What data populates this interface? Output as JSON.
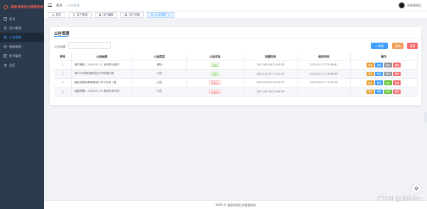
{
  "app": {
    "title": "温泉有家后台管理系统"
  },
  "sidebar": {
    "items": [
      {
        "label": "首页",
        "icon": "dashboard-icon",
        "active": false
      },
      {
        "label": "用户管理",
        "icon": "user-icon",
        "active": false
      },
      {
        "label": "公告管理",
        "icon": "notice-icon",
        "active": true
      },
      {
        "label": "借阅管理",
        "icon": "borrow-icon",
        "active": false
      },
      {
        "label": "图书管理",
        "icon": "book-icon",
        "active": false
      },
      {
        "label": "社区",
        "icon": "community-icon",
        "active": false
      }
    ]
  },
  "header": {
    "breadcrumb": [
      "首页",
      "公告管理"
    ],
    "user_name": "系统管理员"
  },
  "tags": [
    {
      "label": "首页",
      "icon": "home-icon",
      "active": false,
      "closable": false
    },
    {
      "label": "用户管理",
      "icon": "user-icon",
      "active": false,
      "closable": false
    },
    {
      "label": "用户编辑",
      "icon": "grid-icon",
      "active": false,
      "closable": false
    },
    {
      "label": "用户详情",
      "icon": "grid-icon",
      "active": false,
      "closable": false
    },
    {
      "label": "公告管理",
      "icon": "notice-icon",
      "active": true,
      "closable": true
    }
  ],
  "page": {
    "title": "公告管理",
    "search_label": "公告标题",
    "search_value": "",
    "search_placeholder": "",
    "buttons": {
      "add": "+ 新增",
      "search": "查询",
      "reset": "重置"
    }
  },
  "table": {
    "columns": [
      "序号",
      "公告标题",
      "公告类型",
      "公告状态",
      "创建时间",
      "修改时间",
      "操作"
    ],
    "rows": [
      {
        "index": "1",
        "title": "维护通知：2016-07-01 系统进行维护",
        "type": "通知",
        "status": "发布",
        "status_kind": "published",
        "created": "2021-05-18 22:36:33",
        "updated": "2024-12-27 23:18:01",
        "actions": [
          "详情",
          "修改",
          "撤回",
          "删除"
        ],
        "action_kinds": [
          "detail",
          "edit",
          "unpublish",
          "delete"
        ]
      },
      {
        "index": "2",
        "title": "南华大学第四届科技公开授课比赛",
        "type": "公告",
        "status": "发布",
        "status_kind": "published",
        "created": "2024-12-27 17:42:12",
        "updated": "2024-12-27 23:09:29",
        "actions": [
          "详情",
          "修改",
          "撤回",
          "删除"
        ],
        "action_kinds": [
          "detail",
          "edit",
          "unpublish",
          "delete"
        ]
      },
      {
        "index": "3",
        "title": "国家发展改革委等部门关于印发《推",
        "type": "公告",
        "status": "未发布",
        "status_kind": "unpublished",
        "created": "2024-05-29 10:42:20",
        "updated": "2024-05-30 11:42:26",
        "actions": [
          "详情",
          "修改",
          "发布",
          "删除"
        ],
        "action_kinds": [
          "detail",
          "edit",
          "publish",
          "delete"
        ]
      },
      {
        "index": "4",
        "title": "温馨提醒：2016-07-01 新版本发布啦",
        "type": "公告",
        "status": "未发布",
        "status_kind": "unpublished",
        "created": "2021-05-18 22:36:33",
        "updated": "",
        "actions": [
          "详情",
          "修改",
          "发布",
          "删除"
        ],
        "action_kinds": [
          "detail",
          "edit",
          "publish",
          "delete"
        ]
      }
    ]
  },
  "footer": {
    "text": "2026 © 温泉有家后台管理系统"
  },
  "watermark": "CSDN @源码站~",
  "colors": {
    "primary": "#409eff",
    "sidebar_bg": "#2b3a4d",
    "brand": "#e8604c",
    "success": "#67c23a",
    "warning": "#e6a23c",
    "danger": "#f56c6c",
    "info": "#909399"
  }
}
